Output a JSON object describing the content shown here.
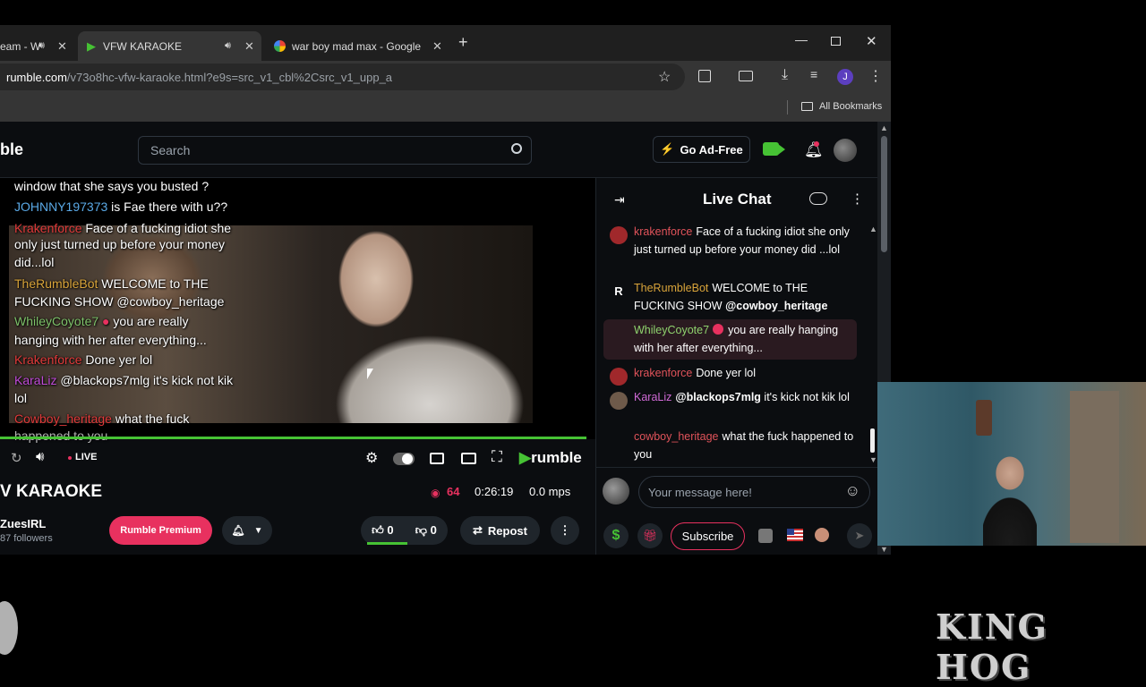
{
  "browser": {
    "tabs": [
      {
        "label": "eam - W"
      },
      {
        "label": "VFW KARAOKE"
      },
      {
        "label": "war boy mad max - Google Sea"
      }
    ],
    "url_domain": "rumble.com",
    "url_path": "/v73o8hc-vfw-karaoke.html?e9s=src_v1_cbl%2Csrc_v1_upp_a",
    "bookmarks_label": "All Bookmarks",
    "profile_initial": "J"
  },
  "header": {
    "logo_fragment": "ble",
    "search_placeholder": "Search",
    "ad_free_label": "Go Ad-Free"
  },
  "video": {
    "overlay_lines": [
      {
        "text": "window that she says you busted ?",
        "color": "#ffffff"
      },
      {
        "user": "JOHNNY197373",
        "text": "is Fae there with u??",
        "color": "#5aa9e6"
      },
      {
        "user": "Krakenforce",
        "text": "Face of a fucking idiot she",
        "color": "#e03a3a"
      },
      {
        "text": "only just turned up before your money",
        "color": "#ffffff"
      },
      {
        "text": "did...lol",
        "color": "#ffffff"
      },
      {
        "user": "TheRumbleBot",
        "text": "WELCOME to THE",
        "color": "#d9a43a"
      },
      {
        "text": "FUCKING SHOW @cowboy_heritage",
        "color": "#ffffff"
      },
      {
        "user": "WhileyCoyote7",
        "text": "you are really",
        "color": "#7ec26a"
      },
      {
        "text": "hanging with her after everything...",
        "color": "#ffffff"
      },
      {
        "user": "Krakenforce",
        "text": "Done yer lol",
        "color": "#e03a3a"
      },
      {
        "user": "KaraLiz",
        "text": "@blackops7mlg it's kick not kik",
        "color": "#c04bd8"
      },
      {
        "text": "lol",
        "color": "#ffffff"
      },
      {
        "user": "Cowboy_heritage",
        "text": "what the fuck",
        "color": "#e03a3a"
      },
      {
        "text": "happened to you",
        "color": "#ffffff"
      }
    ],
    "live_label": "LIVE",
    "brand": "rumble",
    "progress_fraction": 0.98
  },
  "below": {
    "title": "V KARAOKE",
    "viewers": "64",
    "duration": "0:26:19",
    "mps": "0.0 mps",
    "channel_name": "ZuesIRL",
    "followers": "87 followers",
    "premium_label": "Rumble Premium",
    "likes": "0",
    "dislikes": "0",
    "repost_label": "Repost"
  },
  "chat": {
    "title": "Live Chat",
    "messages": [
      {
        "user": "krakenforce",
        "text": "Face of a fucking idiot she only just turned up before your money did ...lol",
        "color": "#e0535a"
      },
      {
        "user": "TheRumbleBot",
        "text": "WELCOME to THE FUCKING SHOW ",
        "mention": "@cowboy_heritage",
        "color": "#d9a43a"
      },
      {
        "user": "WhileyCoyote7",
        "text": "you are really hanging with her after everything...",
        "color": "#8fd36e"
      },
      {
        "user": "krakenforce",
        "text": "Done yer lol",
        "color": "#e0535a"
      },
      {
        "user": "KaraLiz",
        "mention": "@blackops7mlg",
        "text": " it's kick not kik lol",
        "color": "#d06ad6"
      },
      {
        "user": "cowboy_heritage",
        "text": "what the fuck happened to you",
        "color": "#e0535a"
      }
    ],
    "input_placeholder": "Your message here!",
    "subscribe_label": "Subscribe"
  },
  "watermark": "KING HOG",
  "colors": {
    "accent_green": "#46c234",
    "premium_pink": "#e8315f",
    "chat_bg": "#0b0d10"
  }
}
